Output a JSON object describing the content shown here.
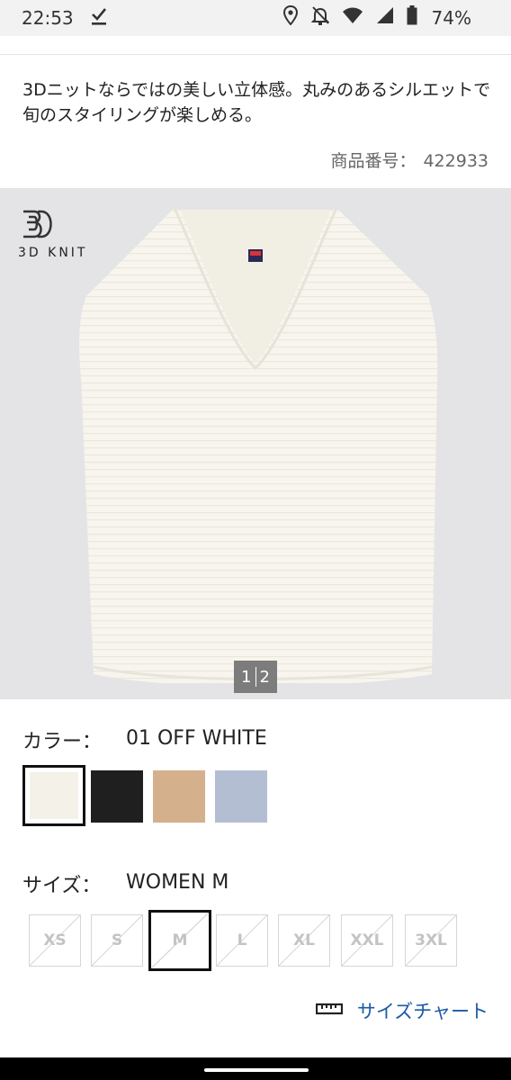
{
  "status_bar": {
    "time": "22:53",
    "battery": "74%"
  },
  "product": {
    "description": "3Dニットならではの美しい立体感。丸みのあるシルエットで旬のスタイリングが楽しめる。",
    "number_label": "商品番号：",
    "number_value": "422933"
  },
  "image": {
    "badge_text": "3D KNIT",
    "pager": {
      "current": "1",
      "total": "2"
    },
    "garment_tag": "UNIQLO"
  },
  "color": {
    "label": "カラー：",
    "value": "01 OFF WHITE",
    "swatches": [
      {
        "name": "off-white",
        "color": "#f4f1e8",
        "selected": true
      },
      {
        "name": "black",
        "color": "#1f1f1f",
        "selected": false
      },
      {
        "name": "beige",
        "color": "#d5b08c",
        "selected": false
      },
      {
        "name": "blue",
        "color": "#b4bed3",
        "selected": false
      }
    ]
  },
  "size": {
    "label": "サイズ：",
    "value": "WOMEN M",
    "options": [
      {
        "label": "XS",
        "selected": false
      },
      {
        "label": "S",
        "selected": false
      },
      {
        "label": "M",
        "selected": true
      },
      {
        "label": "L",
        "selected": false
      },
      {
        "label": "XL",
        "selected": false
      },
      {
        "label": "XXL",
        "selected": false
      },
      {
        "label": "3XL",
        "selected": false
      }
    ],
    "chart_link": "サイズチャート"
  },
  "icons": {
    "status_check": "check-icon",
    "location": "location-icon",
    "notifications_off": "bell-off-icon",
    "wifi": "wifi-icon",
    "signal": "signal-icon",
    "battery": "battery-icon",
    "ruler": "ruler-icon"
  }
}
